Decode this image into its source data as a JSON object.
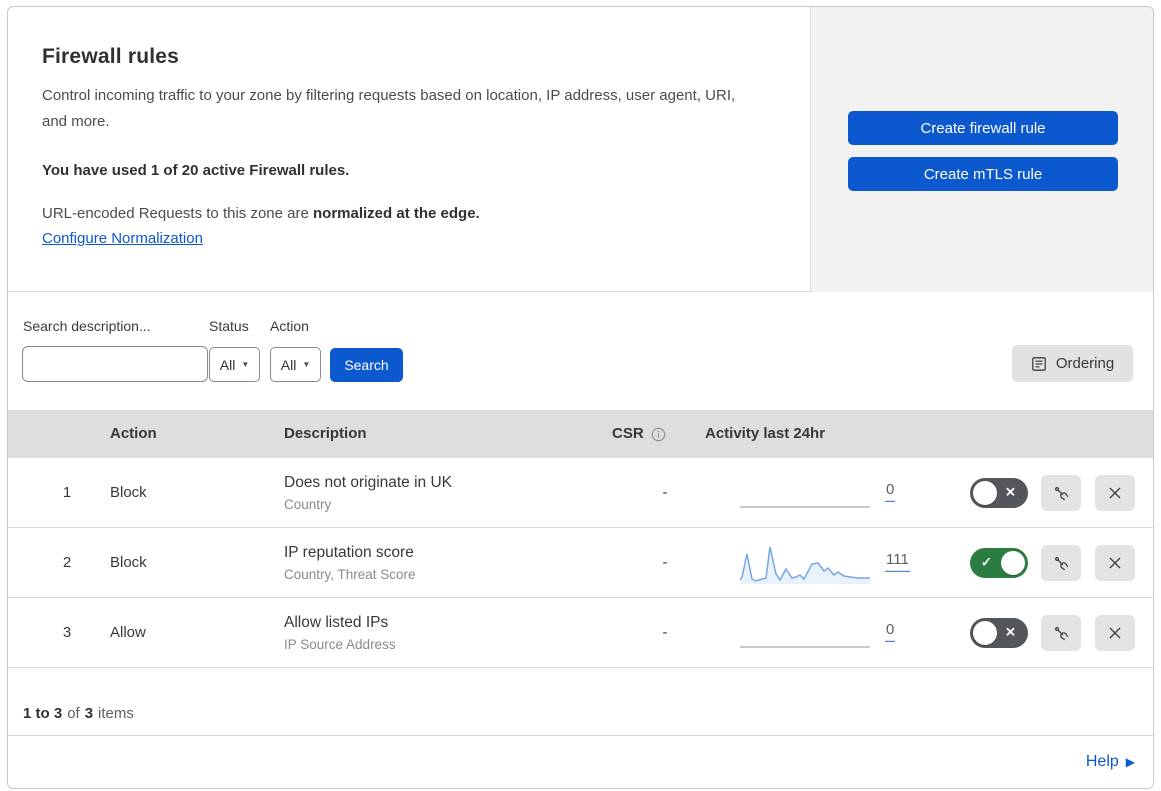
{
  "header": {
    "title": "Firewall rules",
    "description": "Control incoming traffic to your zone by filtering requests based on location, IP address, user agent, URI, and more.",
    "usage": "You have used 1 of 20 active Firewall rules.",
    "normalization_prefix": "URL-encoded Requests to this zone are ",
    "normalization_bold": "normalized at the edge.",
    "normalization_link": "Configure Normalization"
  },
  "actions": {
    "create_firewall_rule_label": "Create firewall rule",
    "create_mtls_rule_label": "Create mTLS rule"
  },
  "filters": {
    "search_label": "Search description...",
    "status_label": "Status",
    "status_value": "All",
    "action_label": "Action",
    "action_value": "All",
    "search_button_label": "Search",
    "ordering_button_label": "Ordering"
  },
  "table": {
    "columns": {
      "action": "Action",
      "description": "Description",
      "csr": "CSR",
      "activity": "Activity last 24hr"
    },
    "rows": [
      {
        "index": "1",
        "action": "Block",
        "description": "Does not originate in UK",
        "criteria": "Country",
        "csr": "-",
        "count": "0",
        "enabled": false,
        "sparkline": null
      },
      {
        "index": "2",
        "action": "Block",
        "description": "IP reputation score",
        "criteria": "Country, Threat Score",
        "csr": "-",
        "count": "111",
        "enabled": true,
        "sparkline": [
          [
            0,
            36
          ],
          [
            2,
            33
          ],
          [
            7,
            10
          ],
          [
            12,
            35
          ],
          [
            16,
            37
          ],
          [
            22,
            35
          ],
          [
            26,
            34
          ],
          [
            30,
            3
          ],
          [
            36,
            30
          ],
          [
            40,
            36
          ],
          [
            46,
            25
          ],
          [
            52,
            34
          ],
          [
            56,
            33
          ],
          [
            60,
            31
          ],
          [
            64,
            35
          ],
          [
            72,
            20
          ],
          [
            78,
            19
          ],
          [
            84,
            27
          ],
          [
            88,
            24
          ],
          [
            94,
            31
          ],
          [
            98,
            28
          ],
          [
            104,
            32
          ],
          [
            110,
            33
          ],
          [
            118,
            34
          ],
          [
            124,
            34
          ],
          [
            130,
            34
          ]
        ]
      },
      {
        "index": "3",
        "action": "Allow",
        "description": "Allow listed IPs",
        "criteria": "IP Source Address",
        "csr": "-",
        "count": "0",
        "enabled": false,
        "sparkline": null
      }
    ],
    "footer": {
      "range": "1 to 3",
      "of": "of",
      "total": "3",
      "items": "items"
    }
  },
  "help": {
    "label": "Help"
  },
  "icons": {
    "caret_glyph": "▼",
    "check_glyph": "✓",
    "cross_glyph": "✕",
    "help_arrow_glyph": "▶"
  },
  "colors": {
    "primary_blue": "#0b58cf",
    "toggle_on_green": "#2b7c41",
    "toggle_off_gray": "#53565b",
    "table_header_gray": "#dedede",
    "side_panel_gray": "#f2f2f2",
    "sparkline_blue": "#76a5e6",
    "sparkline_fill": "rgba(118,165,230,0.16)",
    "flatline_gray": "#c9c9c9"
  }
}
